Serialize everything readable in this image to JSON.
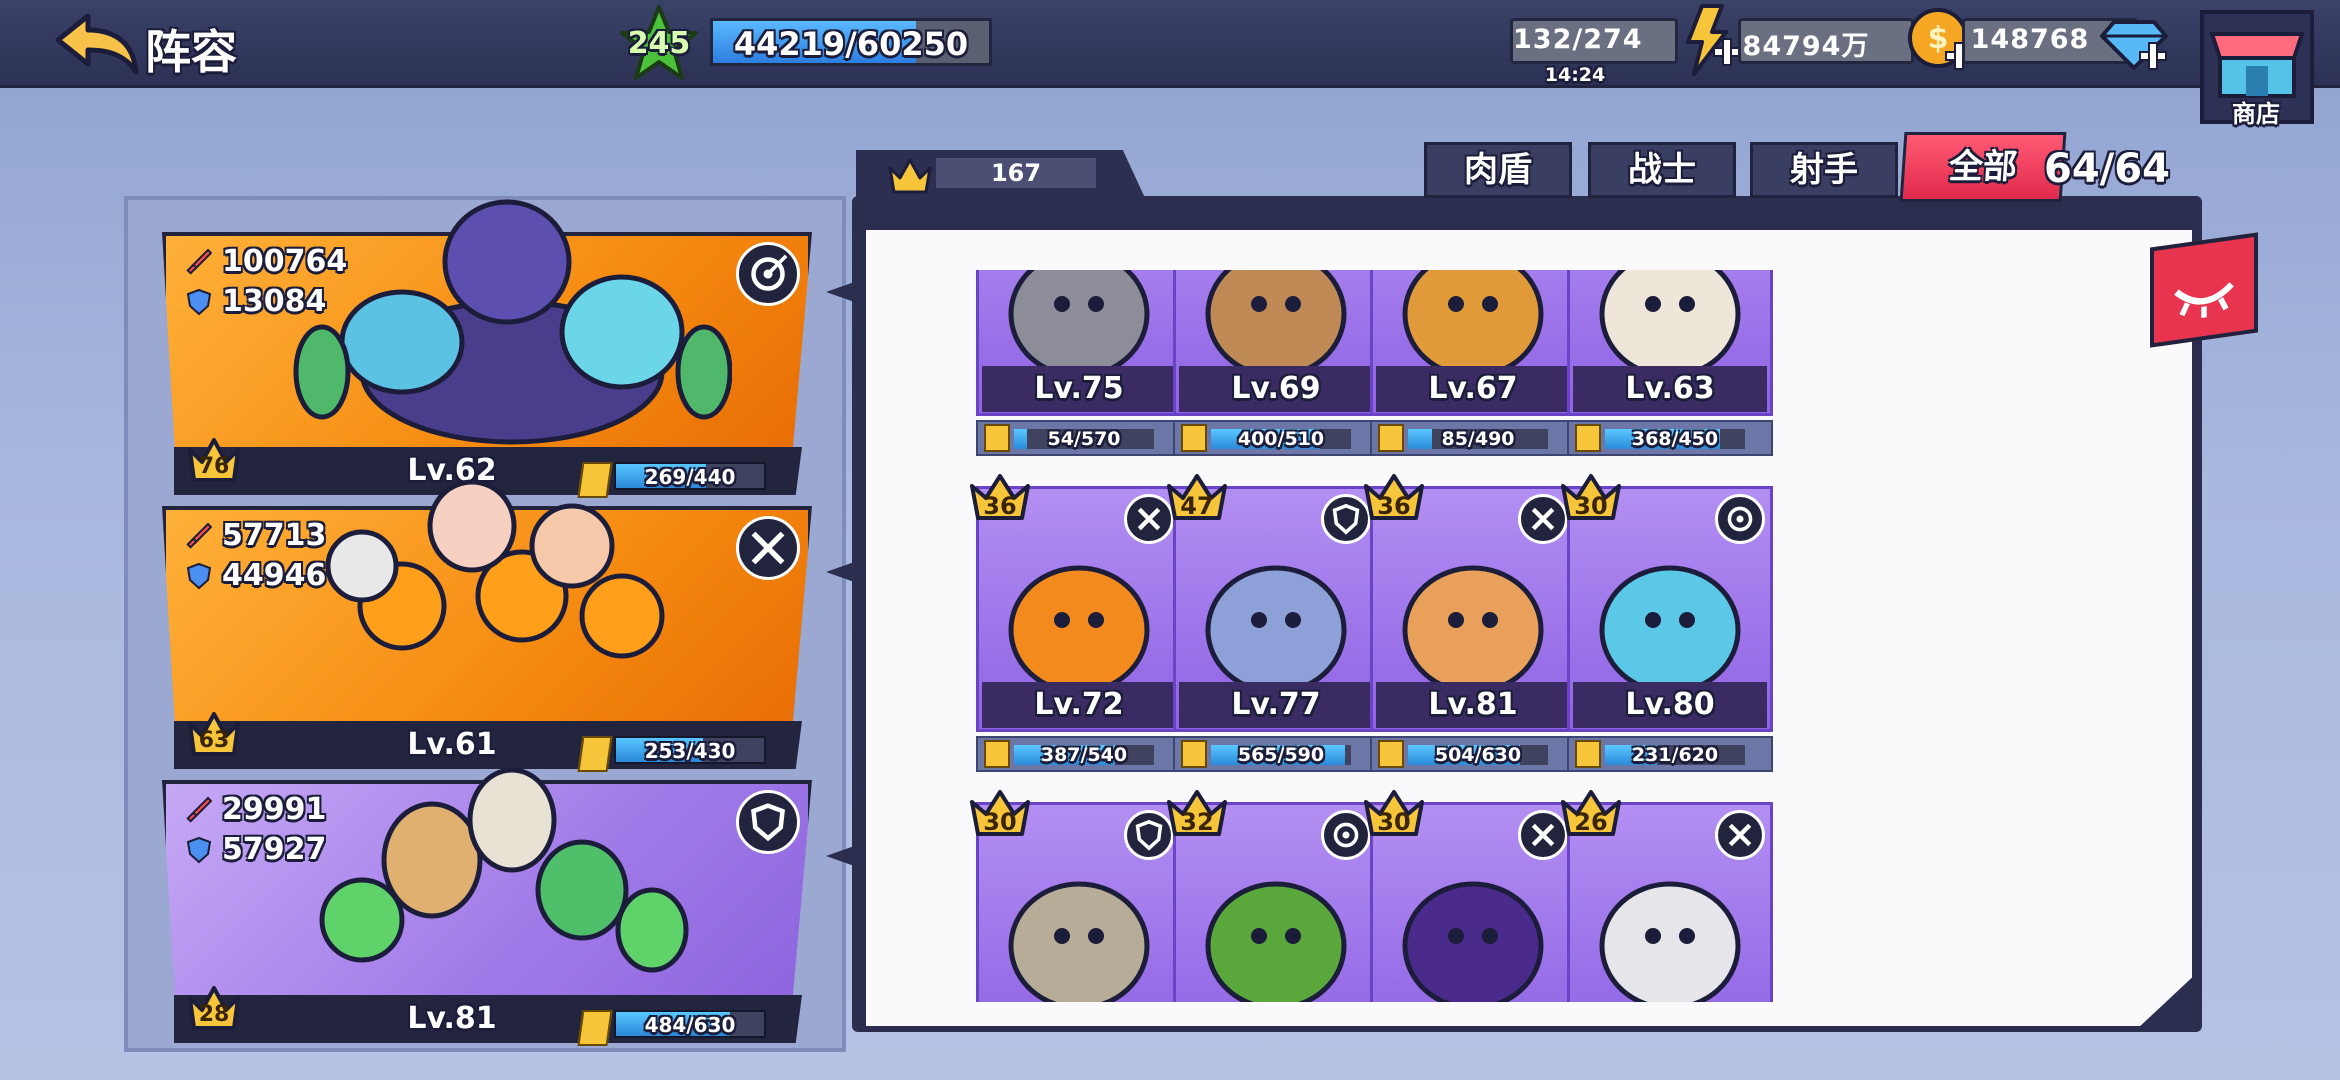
{
  "header": {
    "title": "阵容",
    "level": "245",
    "exp": "44219/60250",
    "exp_fraction": 0.734,
    "stamina": "132/274",
    "stamina_timer": "14:24",
    "coins": "84794万",
    "gems": "148768",
    "shop_label": "商店"
  },
  "teams": [
    {
      "attack": "100764",
      "defense": "13084",
      "stars": "76",
      "level": "Lv.62",
      "fragments": "269/440",
      "fragment_fraction": 0.61,
      "role_icon": "target-icon",
      "theme": "orange"
    },
    {
      "attack": "57713",
      "defense": "44946",
      "stars": "63",
      "level": "Lv.61",
      "fragments": "253/430",
      "fragment_fraction": 0.59,
      "role_icon": "crossed-swords-icon",
      "theme": "orange"
    },
    {
      "attack": "29991",
      "defense": "57927",
      "stars": "28",
      "level": "Lv.81",
      "fragments": "484/630",
      "fragment_fraction": 0.77,
      "role_icon": "shield-icon",
      "theme": "purple"
    }
  ],
  "roster": {
    "crown_total": "167",
    "tabs": [
      "肉盾",
      "战士",
      "射手",
      "全部"
    ],
    "active_tab": "全部",
    "count": "64/64",
    "heroes": [
      {
        "level": "Lv.75",
        "fragments": "54/570",
        "fragment_fraction": 0.09,
        "stars": "",
        "role_icon": "",
        "art": "gray-cat-hero"
      },
      {
        "level": "Lv.69",
        "fragments": "400/510",
        "fragment_fraction": 0.78,
        "stars": "",
        "role_icon": "",
        "art": "bear-hero"
      },
      {
        "level": "Lv.67",
        "fragments": "85/490",
        "fragment_fraction": 0.17,
        "stars": "",
        "role_icon": "",
        "art": "lion-warrior-hero"
      },
      {
        "level": "Lv.63",
        "fragments": "368/450",
        "fragment_fraction": 0.82,
        "stars": "",
        "role_icon": "",
        "art": "goat-hero"
      },
      {
        "level": "Lv.72",
        "fragments": "387/540",
        "fragment_fraction": 0.72,
        "stars": "36",
        "role_icon": "crossed-swords-icon",
        "art": "pumpkin-scarecrow-hero"
      },
      {
        "level": "Lv.77",
        "fragments": "565/590",
        "fragment_fraction": 0.96,
        "stars": "47",
        "role_icon": "shield-icon",
        "art": "werewolf-hero"
      },
      {
        "level": "Lv.81",
        "fragments": "504/630",
        "fragment_fraction": 0.8,
        "stars": "36",
        "role_icon": "crossed-swords-icon",
        "art": "corgi-hero"
      },
      {
        "level": "Lv.80",
        "fragments": "231/620",
        "fragment_fraction": 0.37,
        "stars": "30",
        "role_icon": "target-icon",
        "art": "blue-deer-hero"
      },
      {
        "level": "",
        "fragments": "",
        "fragment_fraction": 0,
        "stars": "30",
        "role_icon": "shield-icon",
        "art": "rock-golem-hero"
      },
      {
        "level": "",
        "fragments": "",
        "fragment_fraction": 0,
        "stars": "32",
        "role_icon": "target-icon",
        "art": "goblin-pirate-hero"
      },
      {
        "level": "",
        "fragments": "",
        "fragment_fraction": 0,
        "stars": "30",
        "role_icon": "crossed-swords-icon",
        "art": "shadow-wizard-hero"
      },
      {
        "level": "",
        "fragments": "",
        "fragment_fraction": 0,
        "stars": "26",
        "role_icon": "crossed-swords-icon",
        "art": "skull-bat-hero"
      }
    ]
  },
  "colors": {
    "accent_red": "#e8344f",
    "frame": "#2b2e4f",
    "card_purple": "#9f79e8",
    "card_orange": "#f58a10",
    "frag_blue": "#3aa6f0",
    "gold": "#f7c53a"
  }
}
